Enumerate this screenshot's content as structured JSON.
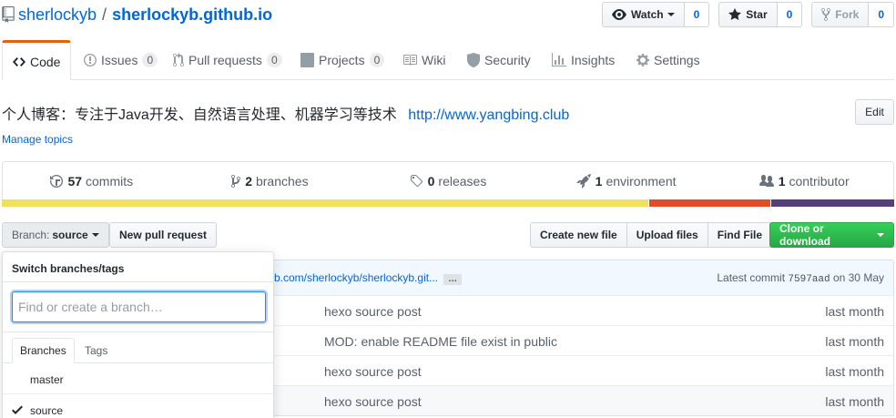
{
  "repo": {
    "owner": "sherlockyb",
    "separator": "/",
    "name": "sherlockyb.github.io"
  },
  "actions": {
    "watch": {
      "label": "Watch",
      "count": "0"
    },
    "star": {
      "label": "Star",
      "count": "0"
    },
    "fork": {
      "label": "Fork",
      "count": "0"
    }
  },
  "tabs": [
    {
      "label": "Code",
      "icon": "code-icon"
    },
    {
      "label": "Issues",
      "count": "0",
      "icon": "issue-icon"
    },
    {
      "label": "Pull requests",
      "count": "0",
      "icon": "pull-request-icon"
    },
    {
      "label": "Projects",
      "count": "0",
      "icon": "project-icon"
    },
    {
      "label": "Wiki",
      "icon": "book-icon"
    },
    {
      "label": "Security",
      "icon": "shield-icon"
    },
    {
      "label": "Insights",
      "icon": "graph-icon"
    },
    {
      "label": "Settings",
      "icon": "gear-icon"
    }
  ],
  "description": {
    "text": "个人博客：专注于Java开发、自然语言处理、机器学习等技术",
    "url": "http://www.yangbing.club",
    "edit_label": "Edit",
    "manage_topics": "Manage topics"
  },
  "summary": [
    {
      "count": "57",
      "label": "commits",
      "icon": "history-icon"
    },
    {
      "count": "2",
      "label": "branches",
      "icon": "branch-icon"
    },
    {
      "count": "0",
      "label": "releases",
      "icon": "tag-icon"
    },
    {
      "count": "1",
      "label": "environment",
      "icon": "rocket-icon"
    },
    {
      "count": "1",
      "label": "contributor",
      "icon": "people-icon"
    }
  ],
  "language_bar": [
    {
      "color": "#f1e05a",
      "percent": 72.6
    },
    {
      "color": "#e34c26",
      "percent": 13.6
    },
    {
      "color": "#563d7c",
      "percent": 13.8
    }
  ],
  "file_nav": {
    "branch_prefix": "Branch:",
    "branch": "source",
    "new_pr": "New pull request",
    "create_file": "Create new file",
    "upload_files": "Upload files",
    "find_file": "Find File",
    "clone": "Clone or download"
  },
  "commit_tease": {
    "message": "b.com/sherlockyb/sherlockyb.git...",
    "ellipsis": "…",
    "latest_prefix": "Latest commit",
    "sha": "7597aad",
    "date": "on 30 May"
  },
  "files": [
    {
      "message": "hexo source post",
      "age": "last month"
    },
    {
      "message": "MOD: enable README file exist in public",
      "age": "last month"
    },
    {
      "message": "hexo source post",
      "age": "last month"
    },
    {
      "message": "hexo source post",
      "age": "last month"
    }
  ],
  "dropdown": {
    "title": "Switch branches/tags",
    "placeholder": "Find or create a branch…",
    "tab_branches": "Branches",
    "tab_tags": "Tags",
    "branches": [
      {
        "name": "master",
        "selected": false
      },
      {
        "name": "source",
        "selected": true
      }
    ]
  }
}
